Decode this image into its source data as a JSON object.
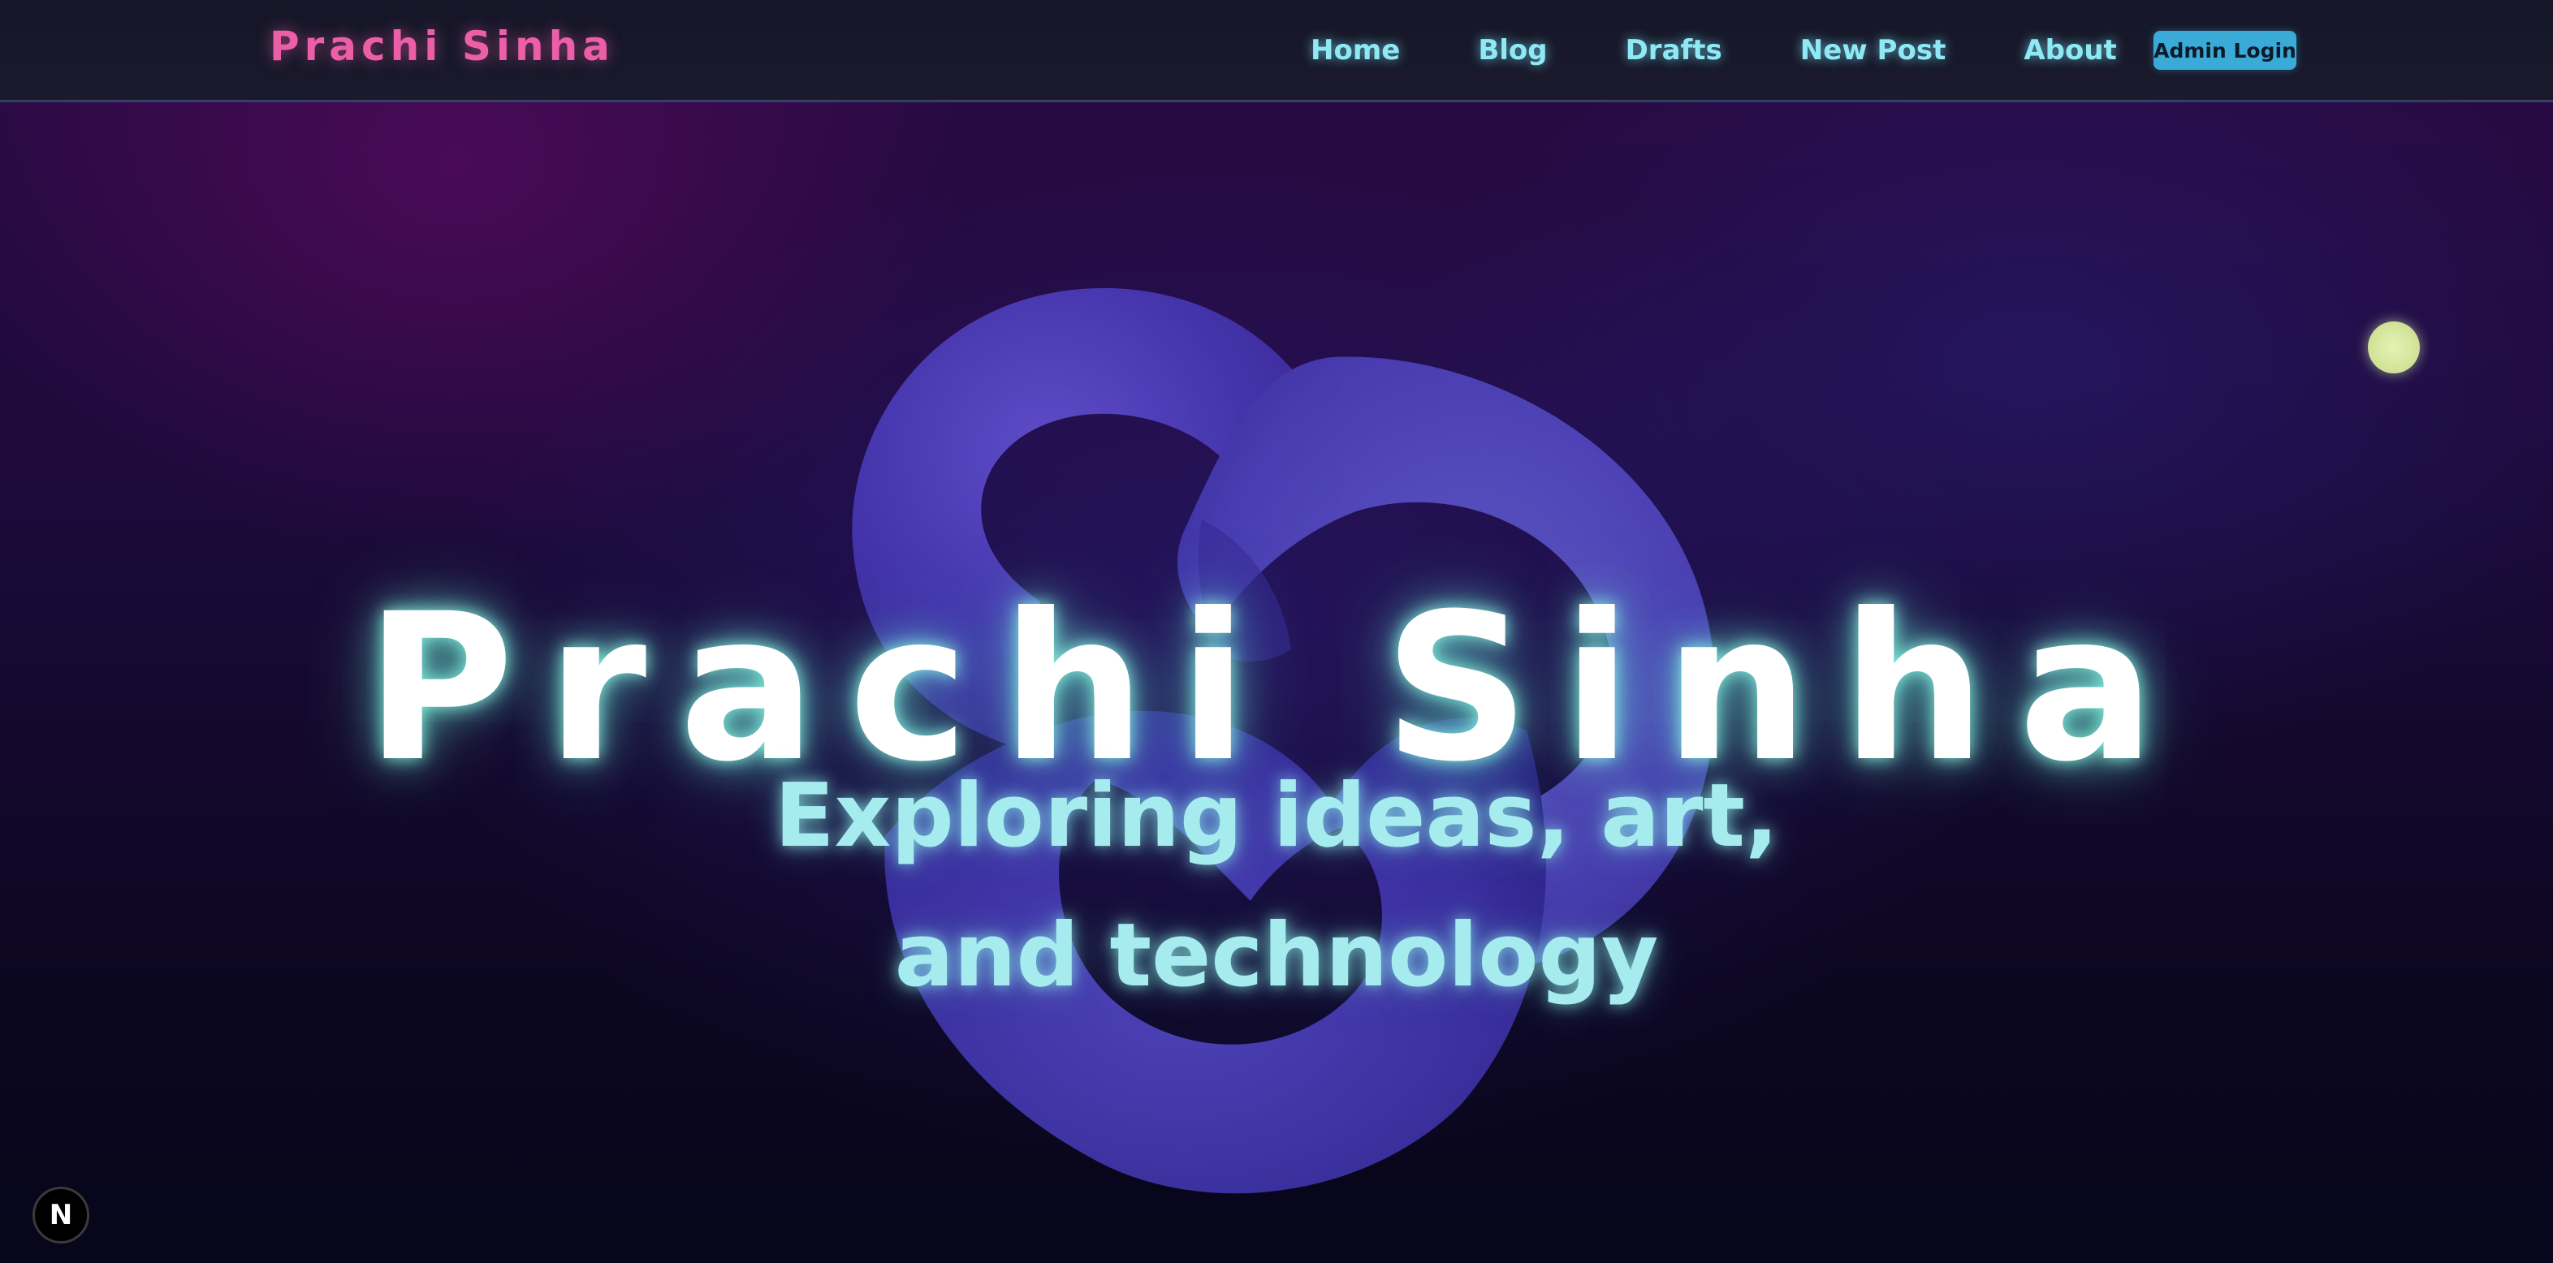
{
  "header": {
    "brand": "Prachi Sinha",
    "nav": [
      {
        "label": "Home"
      },
      {
        "label": "Blog"
      },
      {
        "label": "Drafts"
      },
      {
        "label": "New Post"
      },
      {
        "label": "About"
      }
    ],
    "admin_button": "Admin Login"
  },
  "hero": {
    "title": "Prachi Sinha",
    "subtitle": "Exploring ideas, art, and technology",
    "background_graphic": "knot-shape"
  },
  "dev_badge": {
    "label": "N",
    "icon": "nextjs-icon"
  },
  "colors": {
    "brand": "#ec5fa8",
    "nav_link": "#8fe9f4",
    "admin_button_bg": "#3aaad6",
    "hero_title": "#ffffff",
    "hero_subtitle": "#a6ecef",
    "accent_dot": "#d3e49a",
    "knot": "#5044c4"
  }
}
